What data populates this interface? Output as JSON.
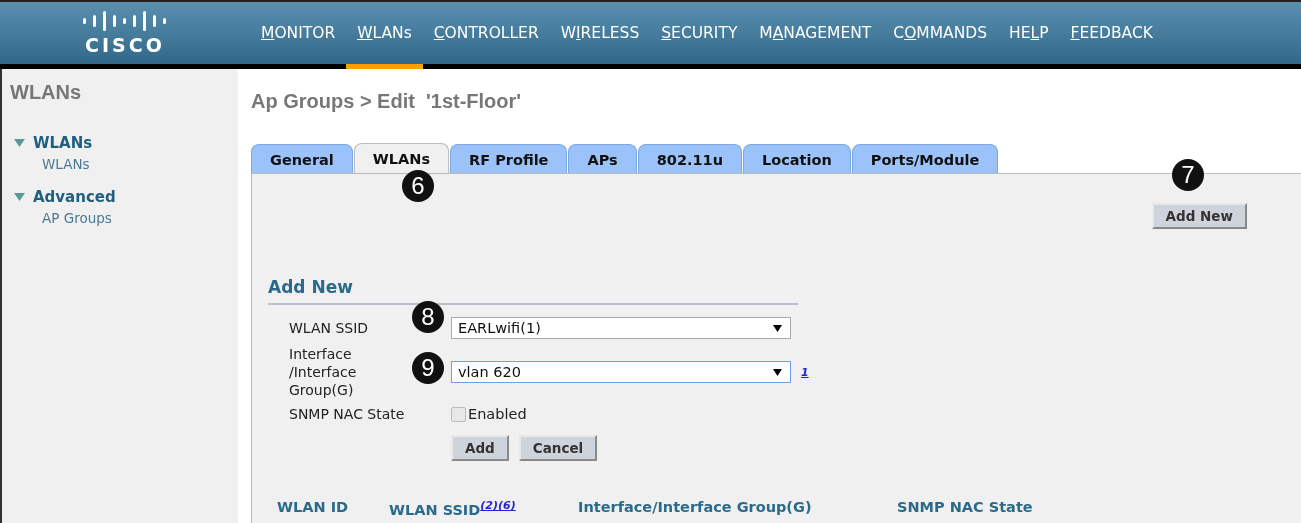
{
  "logo": "CISCO",
  "nav": {
    "items": [
      {
        "key": "M",
        "post": "ONITOR",
        "selected": false
      },
      {
        "key": "W",
        "post": "LANs",
        "selected": true
      },
      {
        "key": "C",
        "post": "ONTROLLER",
        "selected": false
      },
      {
        "pre": "W",
        "key": "I",
        "post": "RELESS",
        "selected": false
      },
      {
        "key": "S",
        "post": "ECURITY",
        "selected": false
      },
      {
        "pre": "M",
        "key": "A",
        "post": "NAGEMENT",
        "selected": false
      },
      {
        "pre": "C",
        "key": "O",
        "post": "MMANDS",
        "selected": false
      },
      {
        "pre": "HE",
        "key": "L",
        "post": "P",
        "selected": false
      },
      {
        "key": "F",
        "post": "EEDBACK",
        "selected": false
      }
    ]
  },
  "sidebar": {
    "title": "WLANs",
    "sections": [
      {
        "label": "WLANs",
        "expanded": true,
        "children": [
          {
            "label": "WLANs"
          }
        ]
      },
      {
        "label": "Advanced",
        "expanded": true,
        "children": [
          {
            "label": "AP Groups"
          }
        ]
      }
    ]
  },
  "page_title": "Ap Groups > Edit  '1st-Floor'",
  "tabs": [
    {
      "label": "General",
      "selected": false
    },
    {
      "label": "WLANs",
      "selected": true
    },
    {
      "label": "RF Profile",
      "selected": false
    },
    {
      "label": "APs",
      "selected": false
    },
    {
      "label": "802.11u",
      "selected": false
    },
    {
      "label": "Location",
      "selected": false
    },
    {
      "label": "Ports/Module",
      "selected": false
    }
  ],
  "add_new_button": "Add New",
  "form": {
    "title": "Add New",
    "wlan_ssid": {
      "label": "WLAN SSID",
      "value": "EARLwifi(1)"
    },
    "interface": {
      "label": "Interface /Interface Group(G)",
      "value": "vlan 620",
      "focused": true,
      "footnote": "1"
    },
    "snmp": {
      "label": "SNMP NAC State",
      "option": "Enabled",
      "checked": false
    },
    "buttons": [
      "Add",
      "Cancel"
    ]
  },
  "table": {
    "columns": [
      {
        "label": "WLAN ID"
      },
      {
        "label": "WLAN SSID",
        "footnote": "(2)(6)"
      },
      {
        "label": "Interface/Interface Group(G)"
      },
      {
        "label": "SNMP NAC State"
      }
    ]
  },
  "callouts": [
    "6",
    "7",
    "8",
    "9"
  ]
}
